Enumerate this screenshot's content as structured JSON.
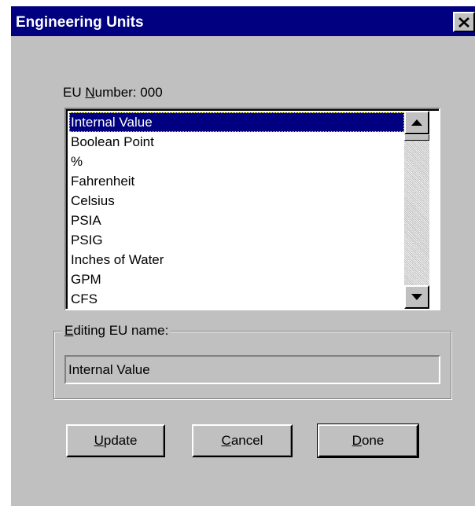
{
  "window": {
    "title": "Engineering Units"
  },
  "eu_number": {
    "label_prefix": "EU ",
    "label_mnemonic": "N",
    "label_rest": "umber:",
    "value": "000"
  },
  "list": {
    "selected_index": 0,
    "items": [
      "Internal Value",
      "Boolean Point",
      "%",
      "Fahrenheit",
      "Celsius",
      "PSIA",
      "PSIG",
      "Inches of Water",
      "GPM",
      "CFS"
    ]
  },
  "editing": {
    "group_label_mnemonic": "E",
    "group_label_rest": "diting EU name:",
    "value": "Internal Value"
  },
  "buttons": {
    "update": {
      "mnemonic": "U",
      "rest": "pdate"
    },
    "cancel": {
      "mnemonic": "C",
      "rest": "ancel"
    },
    "done": {
      "mnemonic": "D",
      "rest": "one"
    }
  }
}
